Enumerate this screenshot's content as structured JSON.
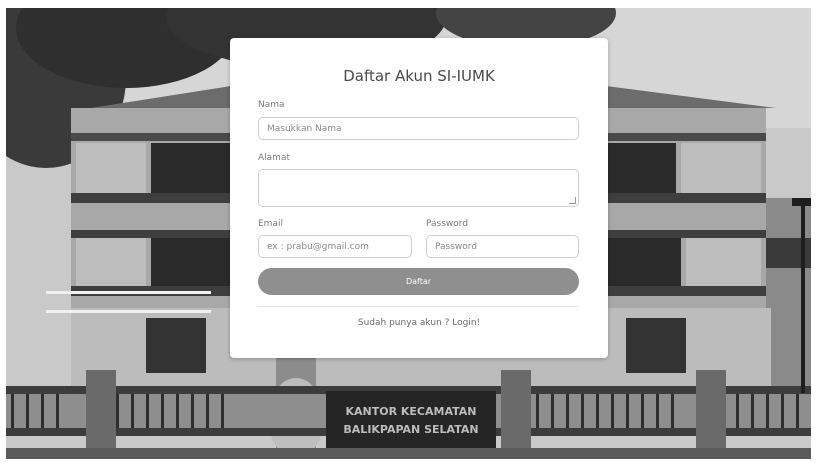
{
  "background": {
    "sign_line1": "KANTOR KECAMATAN",
    "sign_line2": "BALIKPAPAN SELATAN"
  },
  "form": {
    "title": "Daftar Akun SI-IUMK",
    "nama": {
      "label": "Nama",
      "placeholder": "Masukkan Nama",
      "value": ""
    },
    "alamat": {
      "label": "Alamat",
      "placeholder": "",
      "value": ""
    },
    "email": {
      "label": "Email",
      "placeholder": "ex : prabu@gmail.com",
      "value": ""
    },
    "password": {
      "label": "Password",
      "placeholder": "Password",
      "value": ""
    },
    "submit_label": "Daftar",
    "login_link": "Sudah punya akun ? Login!"
  },
  "colors": {
    "card": "#ffffff",
    "button": "#8f8f8f",
    "border": "#cfcfcf"
  }
}
